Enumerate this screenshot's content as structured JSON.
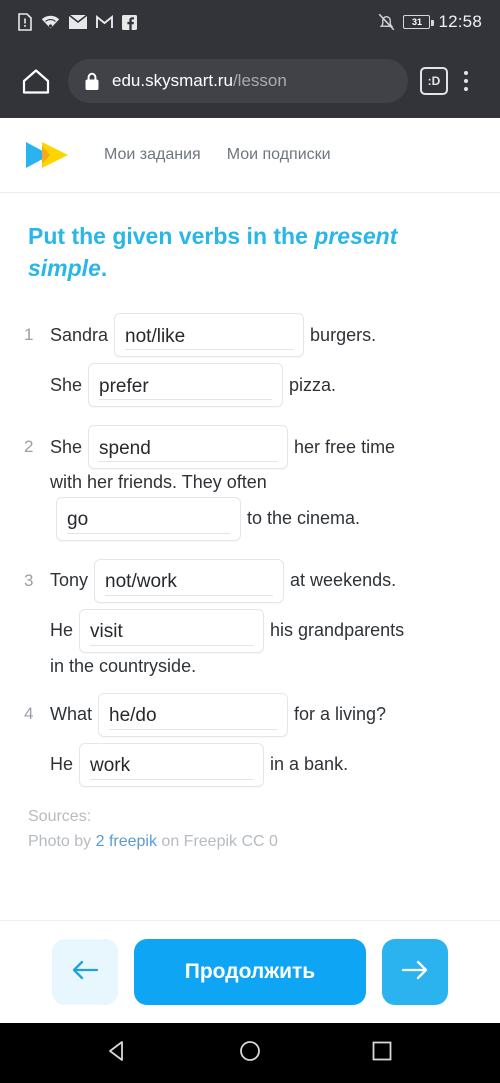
{
  "statusbar": {
    "icons": [
      "document-alert-icon",
      "wifi-icon",
      "mail-icon",
      "gmail-icon",
      "facebook-icon"
    ],
    "mute_icon": "bell-off-icon",
    "battery_level": "31",
    "time": "12:58"
  },
  "browser": {
    "home_icon": "home-icon",
    "lock_icon": "lock-icon",
    "url_domain": "edu.skysmart.ru",
    "url_path": "/lesson",
    "tab_label": ":D",
    "menu_icon": "overflow-menu-icon"
  },
  "site": {
    "logo": "skysmart-logo",
    "nav": [
      {
        "label": "Мои задания"
      },
      {
        "label": "Мои подписки"
      }
    ]
  },
  "task": {
    "title_plain": "Put the given verbs in the ",
    "title_italic": "present simple",
    "title_end": ".",
    "questions": [
      {
        "number": "1",
        "segments": [
          {
            "type": "text",
            "text": "Sandra"
          },
          {
            "type": "blank",
            "value": "not/like",
            "width": "w190"
          },
          {
            "type": "text",
            "text": "burgers."
          },
          {
            "type": "break"
          },
          {
            "type": "text",
            "text": "She"
          },
          {
            "type": "blank",
            "value": "prefer",
            "width": "w195"
          },
          {
            "type": "text",
            "text": "pizza."
          }
        ]
      },
      {
        "number": "2",
        "segments": [
          {
            "type": "text",
            "text": "She"
          },
          {
            "type": "blank",
            "value": "spend",
            "width": "w200"
          },
          {
            "type": "text",
            "text": "her free time"
          },
          {
            "type": "break"
          },
          {
            "type": "text",
            "text": "with her friends. They often"
          },
          {
            "type": "break"
          },
          {
            "type": "blank",
            "value": "go",
            "width": "w185"
          },
          {
            "type": "text",
            "text": "to the cinema."
          }
        ]
      },
      {
        "number": "3",
        "segments": [
          {
            "type": "text",
            "text": "Tony"
          },
          {
            "type": "blank",
            "value": "not/work",
            "width": "w190"
          },
          {
            "type": "text",
            "text": "at weekends."
          },
          {
            "type": "break"
          },
          {
            "type": "text",
            "text": "He"
          },
          {
            "type": "blank",
            "value": "visit",
            "width": "w185"
          },
          {
            "type": "text",
            "text": "his grandparents"
          },
          {
            "type": "break"
          },
          {
            "type": "text",
            "text": "in the countryside."
          }
        ]
      },
      {
        "number": "4",
        "segments": [
          {
            "type": "text",
            "text": "What"
          },
          {
            "type": "blank",
            "value": "he/do",
            "width": "w190"
          },
          {
            "type": "text",
            "text": "for a living?"
          },
          {
            "type": "break"
          },
          {
            "type": "text",
            "text": "He"
          },
          {
            "type": "blank",
            "value": "work",
            "width": "w185"
          },
          {
            "type": "text",
            "text": "in a bank."
          }
        ]
      }
    ]
  },
  "sources": {
    "heading": "Sources:",
    "credit_prefix": "Photo by ",
    "credit_link": "2 freepik",
    "credit_suffix": " on Freepik CC 0"
  },
  "actions": {
    "prev_icon": "arrow-left-icon",
    "continue_label": "Продолжить",
    "next_icon": "arrow-right-icon"
  },
  "android_nav": {
    "back_icon": "triangle-back-icon",
    "home_icon": "circle-home-icon",
    "recents_icon": "square-recents-icon"
  },
  "colors": {
    "accent": "#0fa5f5",
    "title": "#29b6e8",
    "chrome_bg": "#32343a",
    "next_bg": "#2bb3f0",
    "prev_bg": "#e8f7fd"
  }
}
